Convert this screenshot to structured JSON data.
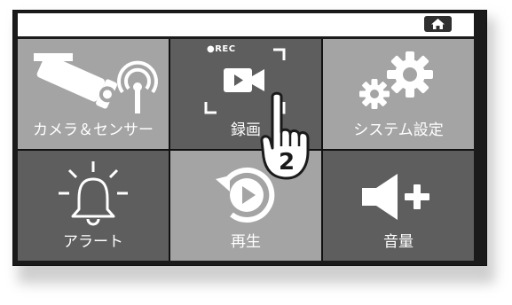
{
  "home_button": {
    "icon": "home-icon"
  },
  "tiles": [
    {
      "label": "カメラ＆センサー",
      "icon": "camera-sensor-icon"
    },
    {
      "label": "録画",
      "icon": "video-record-icon",
      "rec_text": "●REC"
    },
    {
      "label": "システム設定",
      "icon": "gears-icon"
    },
    {
      "label": "アラート",
      "icon": "alert-bell-icon"
    },
    {
      "label": "再生",
      "icon": "replay-icon"
    },
    {
      "label": "音量",
      "icon": "volume-up-icon"
    }
  ],
  "pointer": {
    "icon": "tap-hand-icon",
    "step_number": "2"
  },
  "colors": {
    "tile_light": "#a4a4a4",
    "tile_dark": "#5e5e5e",
    "frame": "#1a1a1a"
  }
}
